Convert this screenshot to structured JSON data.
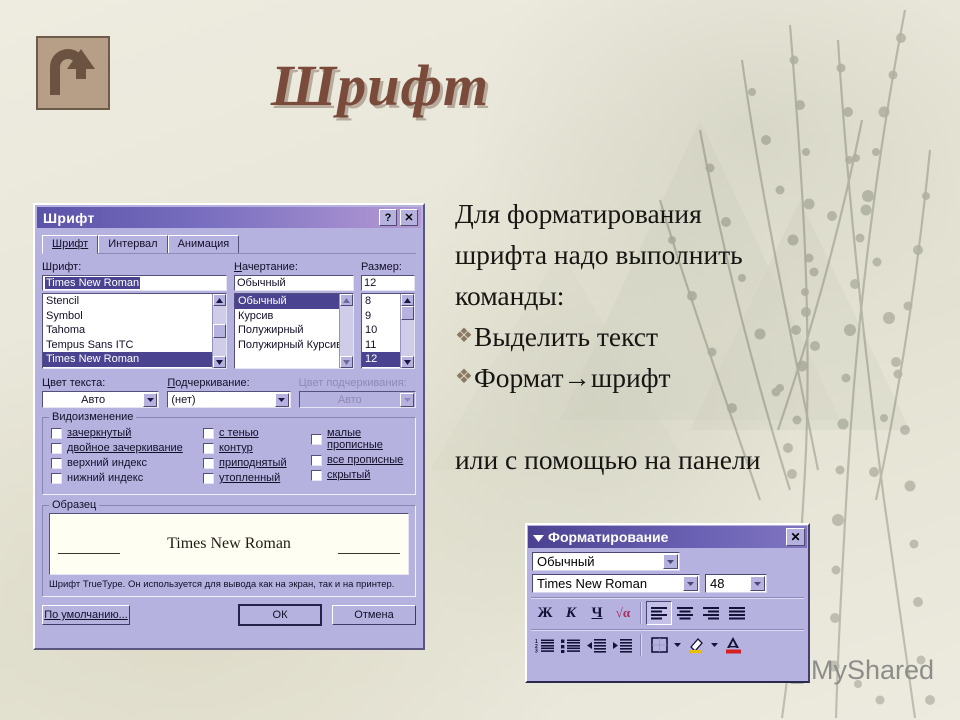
{
  "slide": {
    "title": "Шрифт",
    "back_button_icon": "u-turn-arrow-icon",
    "watermark": "MyShared"
  },
  "body_text": {
    "intro_line1": "Для форматирования",
    "intro_line2": "шрифта надо выполнить",
    "intro_line3": "команды:",
    "bullets": [
      {
        "mark": "❖",
        "text": "Выделить текст"
      },
      {
        "mark": "❖",
        "text_before": "Формат",
        "arrow": "→",
        "text_after": " шрифт"
      }
    ],
    "closing": "или с помощью на панели"
  },
  "font_dialog": {
    "title": "Шрифт",
    "help_button": "?",
    "close_button": "✕",
    "tabs": [
      {
        "label": "Шрифт",
        "active": true
      },
      {
        "label": "Интервал",
        "active": false
      },
      {
        "label": "Анимация",
        "active": false
      }
    ],
    "font": {
      "label": "Шрифт:",
      "value": "Times New Roman",
      "items": [
        "Stencil",
        "Symbol",
        "Tahoma",
        "Tempus Sans ITC",
        "Times New Roman"
      ],
      "selected": "Times New Roman"
    },
    "style": {
      "label": "Начертание:",
      "value": "Обычный",
      "items": [
        "Обычный",
        "Курсив",
        "Полужирный",
        "Полужирный Курсив"
      ],
      "selected": "Обычный"
    },
    "size": {
      "label": "Размер:",
      "value": "12",
      "items": [
        "8",
        "9",
        "10",
        "11",
        "12"
      ],
      "selected": "12"
    },
    "text_color": {
      "label": "Цвет текста:",
      "value": "Авто"
    },
    "underline": {
      "label": "Подчеркивание:",
      "value": "(нет)"
    },
    "underline_color": {
      "label": "Цвет подчеркивания:",
      "value": "Авто",
      "disabled": true
    },
    "effects": {
      "group_label": "Видоизменение",
      "column1": [
        {
          "label": "зачеркнутый",
          "checked": false
        },
        {
          "label": "двойное зачеркивание",
          "checked": false
        },
        {
          "label": "верхний индекс",
          "checked": false
        },
        {
          "label": "нижний индекс",
          "checked": false
        }
      ],
      "column2": [
        {
          "label": "с тенью",
          "checked": false
        },
        {
          "label": "контур",
          "checked": false
        },
        {
          "label": "приподнятый",
          "checked": false
        },
        {
          "label": "утопленный",
          "checked": false
        }
      ],
      "column3": [
        {
          "label": "малые прописные",
          "checked": false
        },
        {
          "label": "все прописные",
          "checked": false
        },
        {
          "label": "скрытый",
          "checked": false
        }
      ]
    },
    "sample": {
      "group_label": "Образец",
      "preview_text": "Times New Roman",
      "note": "Шрифт TrueType. Он используется для вывода как на экран, так и на принтер."
    },
    "buttons": {
      "default": "По умолчанию...",
      "ok": "ОК",
      "cancel": "Отмена"
    }
  },
  "formatting_toolbar": {
    "title": "Форматирование",
    "menu_icon": "chevron-down-icon",
    "close_button": "✕",
    "style_combo": {
      "value": "Обычный"
    },
    "font_combo": {
      "value": "Times New Roman"
    },
    "size_combo": {
      "value": "48"
    },
    "row_format": [
      {
        "name": "bold-button",
        "glyph": "Ж"
      },
      {
        "name": "italic-button",
        "glyph": "К"
      },
      {
        "name": "underline-button",
        "glyph": "Ч"
      },
      {
        "name": "insert-symbol-button",
        "glyph": "√α"
      }
    ],
    "row_align": [
      {
        "name": "align-left-button",
        "pressed": true
      },
      {
        "name": "align-center-button",
        "pressed": false
      },
      {
        "name": "align-right-button",
        "pressed": false
      },
      {
        "name": "align-justify-button",
        "pressed": false
      }
    ],
    "row_lists": [
      {
        "name": "numbered-list-button"
      },
      {
        "name": "bullet-list-button"
      },
      {
        "name": "decrease-indent-button"
      },
      {
        "name": "increase-indent-button"
      },
      {
        "name": "borders-button"
      },
      {
        "name": "highlight-button"
      },
      {
        "name": "font-color-button"
      }
    ]
  },
  "colors": {
    "title_text": "#7a4a3a",
    "dialog_face": "#b6b2e0",
    "titlebar_start": "#5b53a8",
    "titlebar_end": "#b49ad4",
    "selection": "#4a4490",
    "slide_bg": "#e9e7d9"
  }
}
